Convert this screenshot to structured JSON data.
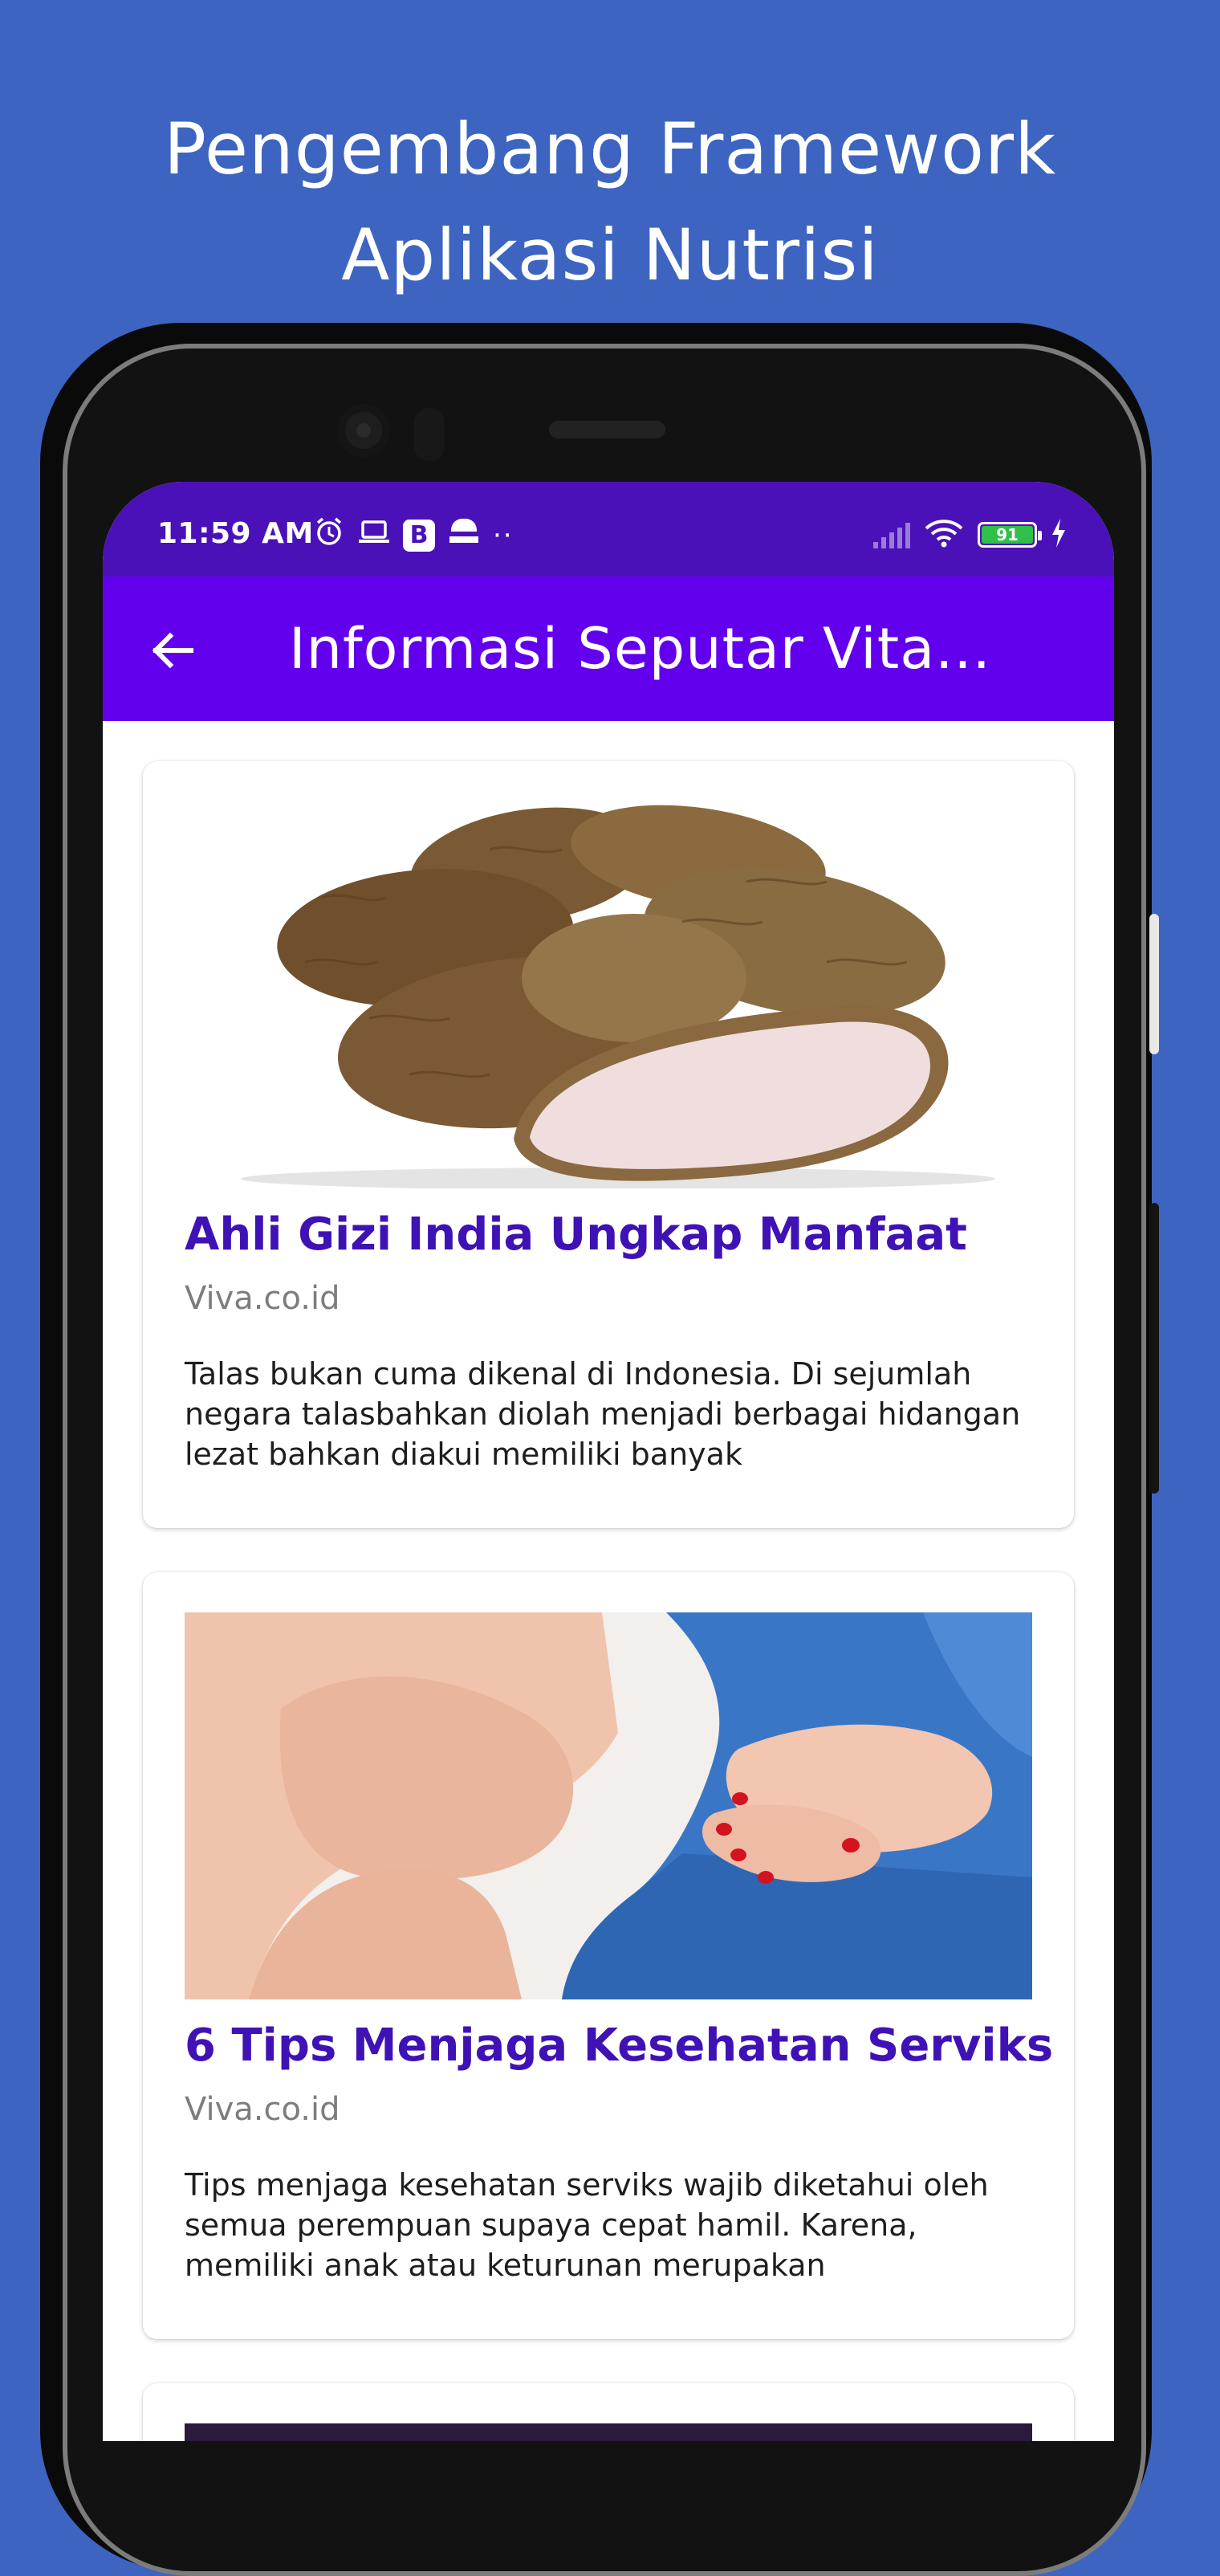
{
  "promo": {
    "line1": "Pengembang Framework",
    "line2": "Aplikasi Nutrisi"
  },
  "status_bar": {
    "time": "11:59 AM",
    "icons": [
      "alarm-icon",
      "laptop-icon",
      "b-app-icon",
      "news-icon",
      "more-dots-icon"
    ],
    "battery": "91",
    "battery_color": "#2fbf4a"
  },
  "app_bar": {
    "title": "Informasi Seputar Vita...",
    "color": "#6200ee",
    "status_color": "#4a11b8"
  },
  "articles": [
    {
      "title": "Ahli Gizi India Ungkap Manfaat",
      "source": "Viva.co.id",
      "description": "Talas bukan cuma dikenal di Indonesia. Di sejumlah negara talasbahkan diolah menjadi berbagai hidangan lezat bahkan diakui memiliki banyak",
      "image": "taro-root-photo"
    },
    {
      "title": "6 Tips Menjaga Kesehatan Serviks",
      "source": "Viva.co.id",
      "description": "Tips menjaga kesehatan serviks wajib diketahui oleh semua perempuan supaya cepat hamil. Karena, memiliki anak atau keturunan merupakan",
      "image": "woman-hands-on-lap-photo"
    }
  ],
  "colors": {
    "background": "#3d64c0",
    "title_text": "#3f12b5",
    "source_text": "#7d7d7d"
  }
}
